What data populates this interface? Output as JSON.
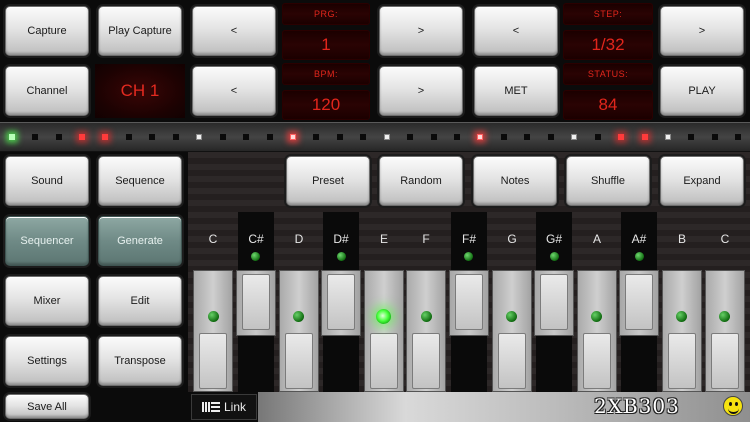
{
  "top_row": {
    "capture": "Capture",
    "play_capture": "Play Capture",
    "prg_prev": "<",
    "prg_label": "PRG:",
    "prg_value": "1",
    "prg_next": ">",
    "step_prev": "<",
    "step_label": "STEP:",
    "step_value": "1/32",
    "step_next": ">"
  },
  "second_row": {
    "channel": "Channel",
    "channel_value": "CH 1",
    "bpm_prev": "<",
    "bpm_label": "BPM:",
    "bpm_value": "120",
    "bpm_next": ">",
    "met": "MET",
    "status_label": "STATUS:",
    "status_value": "84",
    "play": "PLAY"
  },
  "step_indicators": [
    "green",
    "off",
    "off",
    "red",
    "red",
    "off",
    "off",
    "off",
    "white",
    "off",
    "off",
    "off",
    "redw",
    "off",
    "off",
    "off",
    "white",
    "off",
    "off",
    "off",
    "redw",
    "off",
    "off",
    "off",
    "white",
    "off",
    "red",
    "red",
    "white",
    "off",
    "off",
    "off"
  ],
  "nav": {
    "sound": "Sound",
    "sequence": "Sequence",
    "sequencer": "Sequencer",
    "generate": "Generate",
    "mixer": "Mixer",
    "edit": "Edit",
    "settings": "Settings",
    "transpose": "Transpose",
    "save_all": "Save All"
  },
  "tools": {
    "preset": "Preset",
    "random": "Random",
    "notes": "Notes",
    "shuffle": "Shuffle",
    "expand": "Expand"
  },
  "keyboard": {
    "notes": [
      "C",
      "C#",
      "D",
      "D#",
      "E",
      "F",
      "F#",
      "G",
      "G#",
      "A",
      "A#",
      "B",
      "C"
    ],
    "active_note": "E"
  },
  "footer": {
    "link_label": "Link",
    "brand": "2XB303",
    "smiley_icon": "smiley-icon"
  },
  "colors": {
    "led_red": "#e1261c",
    "key_led_green": "#48ff3c",
    "panel_teal": "#6f8a86"
  }
}
